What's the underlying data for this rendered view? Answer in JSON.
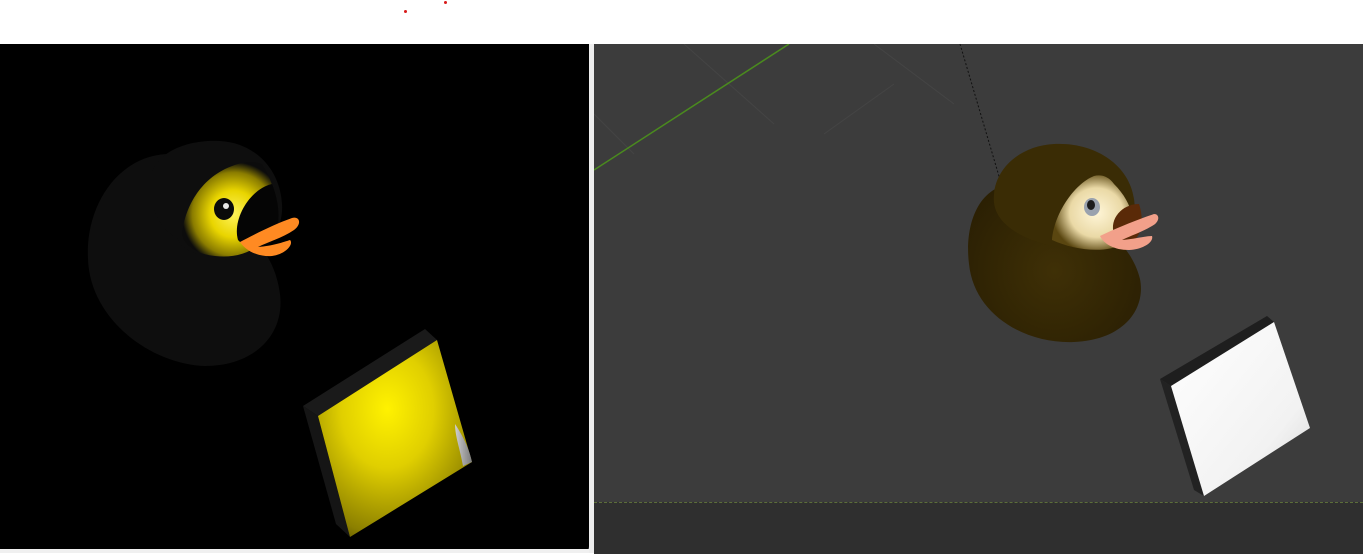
{
  "scene": {
    "left_view": {
      "name": "rendered-preview",
      "background": "#000000",
      "objects": [
        "duck-model",
        "lit-box"
      ]
    },
    "right_view": {
      "name": "editor-viewport",
      "background": "#3c3c3c",
      "objects": [
        "duck-model",
        "white-box",
        "grid-axis"
      ]
    }
  },
  "colors": {
    "duck_yellow": "#f2e20c",
    "duck_editor_body": "#3a2c05",
    "duck_editor_head": "#efe2b0",
    "beak_orange": "#ff8a22",
    "beak_pink": "#f2a08a",
    "box_yellow": "#e8d800",
    "axis_green": "#4a8a1e",
    "marker_red": "#d81a1a"
  }
}
